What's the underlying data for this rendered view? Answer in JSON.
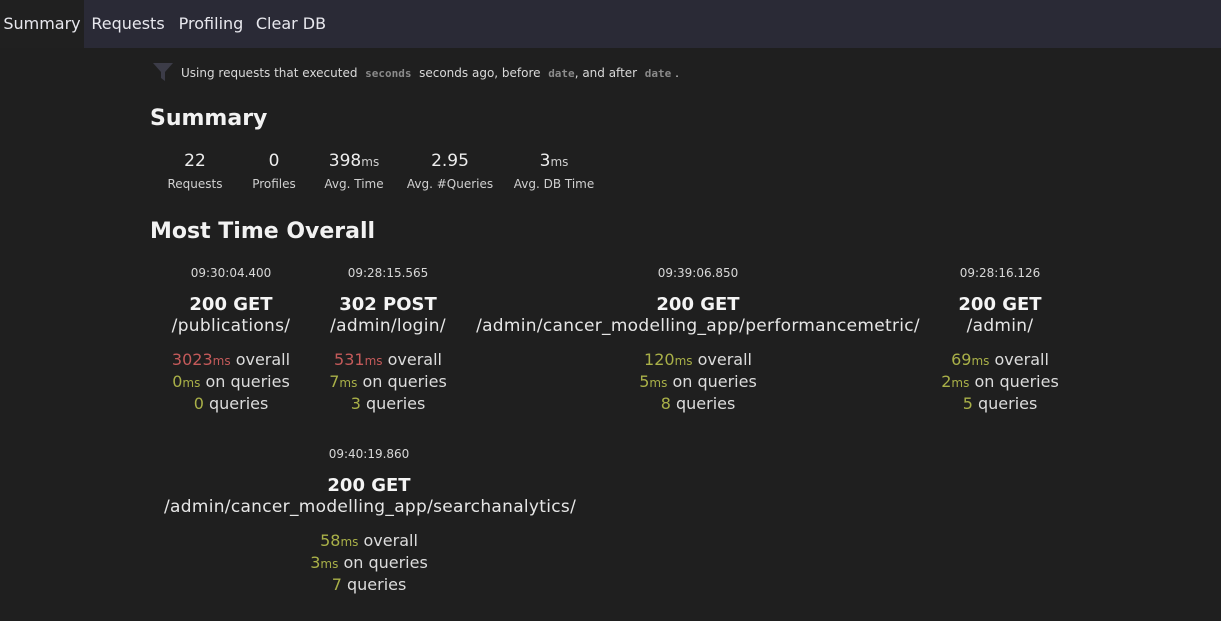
{
  "nav": {
    "tabs": [
      "Summary",
      "Requests",
      "Profiling",
      "Clear DB"
    ],
    "active": "Summary"
  },
  "filter": {
    "prefix": "Using requests that executed",
    "seconds_code": "seconds",
    "middle": "seconds ago, before",
    "date_code_1": "date",
    "after": ", and after",
    "date_code_2": "date",
    "end": "."
  },
  "summary": {
    "title": "Summary",
    "stats": [
      {
        "value": "22",
        "unit": "",
        "label": "Requests"
      },
      {
        "value": "0",
        "unit": "",
        "label": "Profiles"
      },
      {
        "value": "398",
        "unit": "ms",
        "label": "Avg. Time"
      },
      {
        "value": "2.95",
        "unit": "",
        "label": "Avg. #Queries"
      },
      {
        "value": "3",
        "unit": "ms",
        "label": "Avg. DB Time"
      }
    ]
  },
  "most_time": {
    "title": "Most Time Overall",
    "overall_label": "overall",
    "queries_time_label": "on queries",
    "queries_label": "queries",
    "ms_unit": "ms",
    "cards": [
      {
        "time": "09:30:04.400",
        "method": "200 GET",
        "path": "/publications/",
        "overall": "3023",
        "query_time": "0",
        "queries": "0",
        "overall_color": "#c45a5a"
      },
      {
        "time": "09:28:15.565",
        "method": "302 POST",
        "path": "/admin/login/",
        "overall": "531",
        "query_time": "7",
        "queries": "3",
        "overall_color": "#c45a5a"
      },
      {
        "time": "09:39:06.850",
        "method": "200 GET",
        "path": "/admin/cancer_modelling_app/performancemetric/",
        "overall": "120",
        "query_time": "5",
        "queries": "8",
        "overall_color": "#a9b048"
      },
      {
        "time": "09:28:16.126",
        "method": "200 GET",
        "path": "/admin/",
        "overall": "69",
        "query_time": "2",
        "queries": "5",
        "overall_color": "#a9b048"
      },
      {
        "time": "09:40:19.860",
        "method": "200 GET",
        "path": "/admin/cancer_modelling_app/searchanalytics/",
        "overall": "58",
        "query_time": "3",
        "queries": "7",
        "overall_color": "#a9b048"
      }
    ]
  },
  "colors": {
    "nav_bg": "#2a2a36",
    "page_bg": "#1f1f1f",
    "slow": "#c45a5a",
    "ok": "#a9b048"
  }
}
